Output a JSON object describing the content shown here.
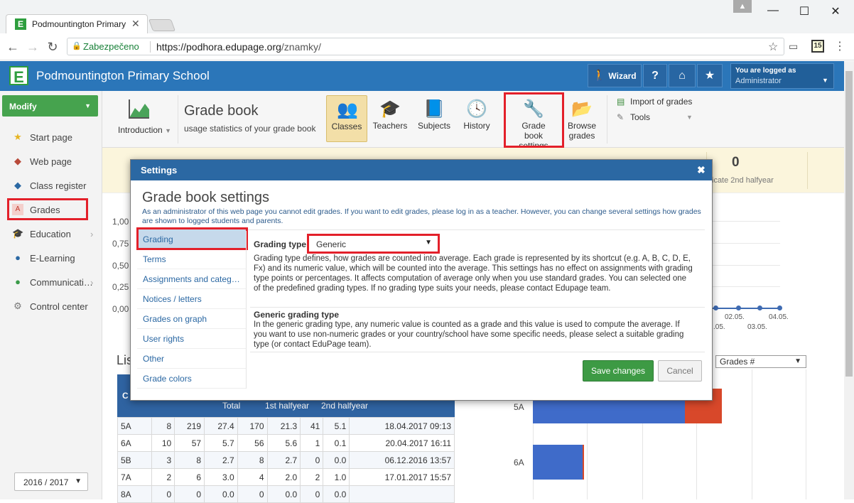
{
  "browser": {
    "tab_title": "Podmountington Primary",
    "secure_label": "Zabezpečeno",
    "url_host": "https://podhora.edupage.org",
    "url_path": "/znamky/",
    "ext_badge": "15"
  },
  "app": {
    "school_name": "Podmountington Primary School",
    "logo_letter": "E",
    "wizard_label": "Wizard",
    "help_label": "?",
    "logged_in_label": "You are logged as",
    "user_role": "Administrator"
  },
  "sidebar": {
    "modify_label": "Modify",
    "items": [
      {
        "label": "Start page",
        "icon": "star-icon"
      },
      {
        "label": "Web page",
        "icon": "web-icon"
      },
      {
        "label": "Class register",
        "icon": "book-icon"
      },
      {
        "label": "Grades",
        "icon": "grades-icon"
      },
      {
        "label": "Education",
        "icon": "education-icon"
      },
      {
        "label": "E-Learning",
        "icon": "globe-icon"
      },
      {
        "label": "Communicati…",
        "icon": "communication-icon"
      },
      {
        "label": "Control center",
        "icon": "gear-icon"
      }
    ],
    "year": "2016 / 2017"
  },
  "toolbar": {
    "introduction": "Introduction",
    "title": "Grade book",
    "subtitle": "usage statistics of your grade book",
    "buttons": [
      "Classes",
      "Teachers",
      "Subjects",
      "History",
      "Grade book settings",
      "Browse grades"
    ],
    "gb_settings_line1": "Grade book",
    "gb_settings_line2": "settings",
    "browse_line1": "Browse",
    "browse_line2": "grades",
    "import": "Import of grades",
    "tools": "Tools"
  },
  "stats": {
    "last_value": "0",
    "last_label": "icate 2nd halfyear"
  },
  "chart": {
    "yticks": [
      "1,00",
      "0,75",
      "0,50",
      "0,25",
      "0,00"
    ],
    "xticks_top": [
      "02.05.",
      "04.05."
    ],
    "xticks_bottom": [
      ".05.",
      "03.05."
    ]
  },
  "list": {
    "title": "Lis",
    "col_c": "C",
    "col_total": "Total",
    "col_h1": "1st halfyear",
    "col_h2": "2nd halfyear",
    "rows": [
      [
        "5A",
        "8",
        "219",
        "27.4",
        "170",
        "21.3",
        "41",
        "5.1",
        "18.04.2017 09:13"
      ],
      [
        "6A",
        "10",
        "57",
        "5.7",
        "56",
        "5.6",
        "1",
        "0.1",
        "20.04.2017 16:11"
      ],
      [
        "5B",
        "3",
        "8",
        "2.7",
        "8",
        "2.7",
        "0",
        "0.0",
        "06.12.2016 13:57"
      ],
      [
        "7A",
        "2",
        "6",
        "3.0",
        "4",
        "2.0",
        "2",
        "1.0",
        "17.01.2017 15:57"
      ],
      [
        "8A",
        "0",
        "0",
        "0.0",
        "0",
        "0.0",
        "0",
        "0.0",
        ""
      ]
    ]
  },
  "bar_chart": {
    "select_value": "Grades #",
    "labels": [
      "5A",
      "6A"
    ]
  },
  "modal": {
    "header": "Settings",
    "title": "Grade book settings",
    "note": "As an administrator of this web page you cannot edit grades. If you want to edit grades, please log in as a teacher. However, you can change several settings how grades are shown to logged students and parents.",
    "nav": [
      "Grading",
      "Terms",
      "Assignments and categ…",
      "Notices / letters",
      "Grades on graph",
      "User rights",
      "Other",
      "Grade colors"
    ],
    "grading_type_label": "Grading type:",
    "grading_type_value": "Generic",
    "grading_desc": "Grading type defines, how grades are counted into average. Each grade is represented by its shortcut (e.g. A, B, C, D, E, Fx) and its numeric value, which will be counted into the average. This settings has no effect on assignments with grading type points or percentages. It affects computation of average only when you use standard grades. You can selected one of the predefined grading types. If no grading type suits your needs, please contact Edupage team.",
    "generic_title": "Generic grading type",
    "generic_desc": "In the generic grading type, any numeric value is counted as a grade and this value is used to compute the average. If you want to use non-numeric grades or your country/school have some specific needs, please select a suitable grading type (or contact EduPage team).",
    "save": "Save changes",
    "cancel": "Cancel"
  }
}
